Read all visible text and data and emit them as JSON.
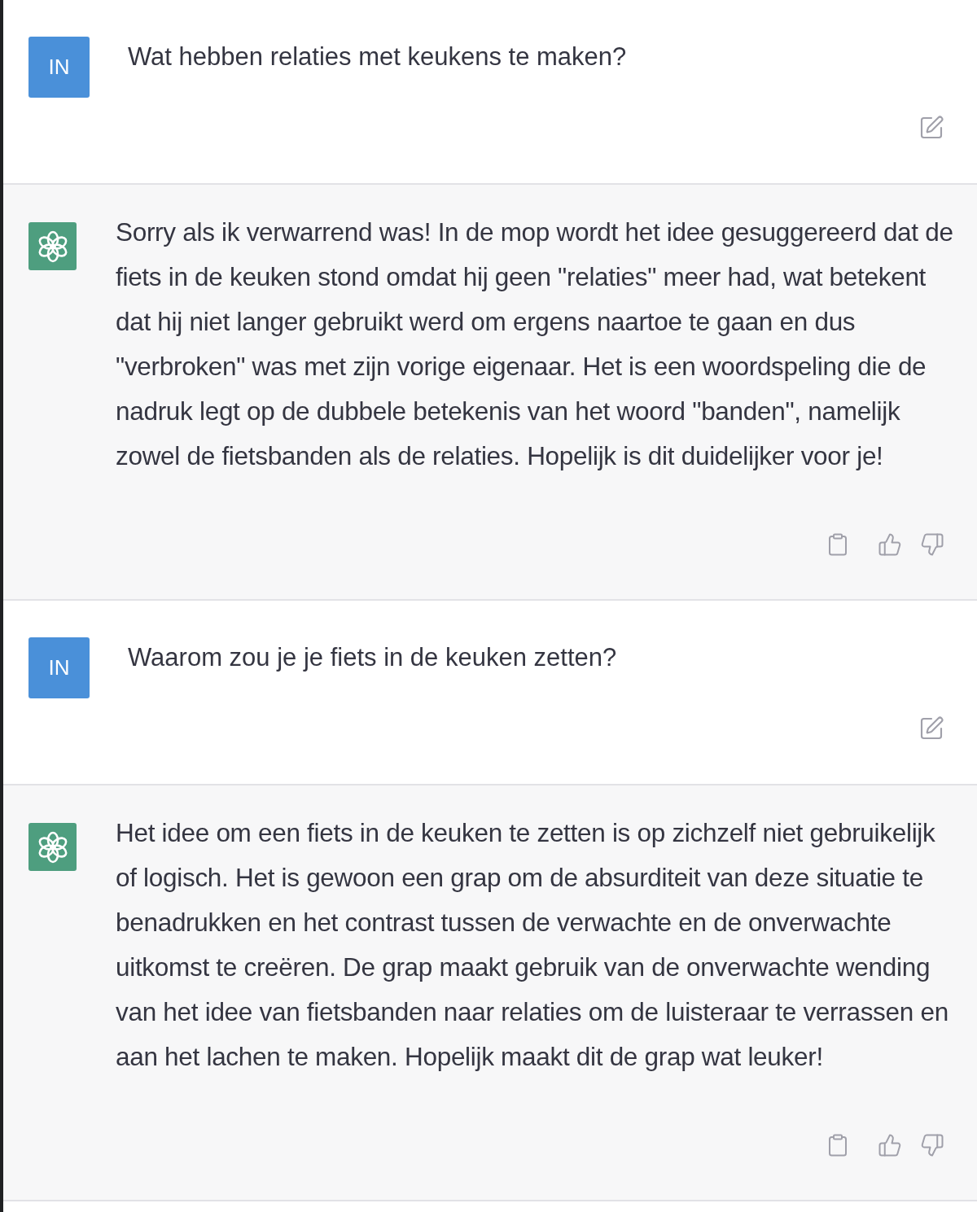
{
  "messages": [
    {
      "kind": "user",
      "avatar": "IN",
      "text": "Wat hebben relaties met keukens te maken?"
    },
    {
      "kind": "assistant",
      "text": "Sorry als ik verwarrend was! In de mop wordt het idee gesuggereerd dat de fiets in de keuken stond omdat hij geen \"relaties\" meer had, wat betekent dat hij niet langer gebruikt werd om ergens naartoe te gaan en dus \"verbroken\" was met zijn vorige eigenaar. Het is een woordspeling die de nadruk legt op de dubbele betekenis van het woord \"banden\", namelijk zowel de fietsbanden als de relaties. Hopelijk is dit duidelijker voor je!"
    },
    {
      "kind": "user",
      "avatar": "IN",
      "text": "Waarom zou je je fiets in de keuken zetten?"
    },
    {
      "kind": "assistant",
      "text": "Het idee om een fiets in de keuken te zetten is op zichzelf niet gebruikelijk of logisch. Het is gewoon een grap om de absurditeit van deze situatie te benadrukken en het contrast tussen de verwachte en de onverwachte uitkomst te creëren. De grap maakt gebruik van de onverwachte wending van het idee van fietsbanden naar relaties om de luisteraar te verrassen en aan het lachen te maken. Hopelijk maakt dit de grap wat leuker!"
    }
  ]
}
